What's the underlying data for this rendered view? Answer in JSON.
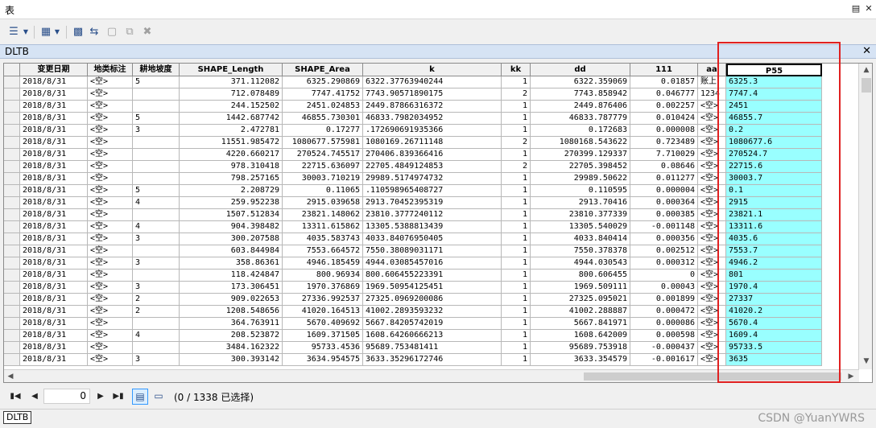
{
  "window": {
    "title": "表"
  },
  "title_controls": [
    "pin-icon",
    "close-icon"
  ],
  "tab": {
    "name": "DLTB"
  },
  "columns": [
    "",
    "变更日期",
    "地类标注",
    "耕地坡度",
    "SHAPE_Length",
    "SHAPE_Area",
    "k",
    "kk",
    "dd",
    "111",
    "aa",
    "P55"
  ],
  "rows": [
    [
      "2018/8/31",
      "<空>",
      "5",
      "371.112082",
      "6325.290869",
      "6322.37763940244",
      "1",
      "6322.359069",
      "0.01857",
      "账上",
      "6325.3"
    ],
    [
      "2018/8/31",
      "<空>",
      "",
      "712.078489",
      "7747.41752",
      "7743.9057189017​5",
      "2",
      "7743.858942",
      "0.046777",
      "1234",
      "7747.4"
    ],
    [
      "2018/8/31",
      "<空>",
      "",
      "244.152502",
      "2451.024853",
      "2449.87866316372",
      "1",
      "2449.876406",
      "0.002257",
      "<空>",
      "2451"
    ],
    [
      "2018/8/31",
      "<空>",
      "5",
      "1442.687742",
      "46855.730301",
      "46833.7982034952",
      "1",
      "46833.787779",
      "0.010424",
      "<空>",
      "46855.7"
    ],
    [
      "2018/8/31",
      "<空>",
      "3",
      "2.472781",
      "0.17277",
      ".172690691935366",
      "1",
      "0.172683",
      "0.000008",
      "<空>",
      "0.2"
    ],
    [
      "2018/8/31",
      "<空>",
      "",
      "11551.985472",
      "1080677.575981",
      "1080169.26711148",
      "2",
      "1080168.543622",
      "0.723489",
      "<空>",
      "1080677.6"
    ],
    [
      "2018/8/31",
      "<空>",
      "",
      "4220.660217",
      "270524.745517",
      "270406.839366416",
      "1",
      "270399.129337",
      "7.710029",
      "<空>",
      "270524.7"
    ],
    [
      "2018/8/31",
      "<空>",
      "",
      "978.310418",
      "22715.636097",
      "22705.4849124853",
      "2",
      "22705.398452",
      "0.08646",
      "<空>",
      "22715.6"
    ],
    [
      "2018/8/31",
      "<空>",
      "",
      "798.257165",
      "30003.710219",
      "29989.5174974732",
      "1",
      "29989.50622",
      "0.011277",
      "<空>",
      "30003.7"
    ],
    [
      "2018/8/31",
      "<空>",
      "5",
      "2.208729",
      "0.11065",
      ".110598965408727",
      "1",
      "0.110595",
      "0.000004",
      "<空>",
      "0.1"
    ],
    [
      "2018/8/31",
      "<空>",
      "4",
      "259.952238",
      "2915.039658",
      "2913.70452395319",
      "1",
      "2913.70416",
      "0.000364",
      "<空>",
      "2915"
    ],
    [
      "2018/8/31",
      "<空>",
      "",
      "1507.512834",
      "23821.148062",
      "23810.3777240112",
      "1",
      "23810.377339",
      "0.000385",
      "<空>",
      "23821.1"
    ],
    [
      "2018/8/31",
      "<空>",
      "4",
      "904.398482",
      "13311.615862",
      "13305.5388813439",
      "1",
      "13305.540029",
      "-0.001148",
      "<空>",
      "13311.6"
    ],
    [
      "2018/8/31",
      "<空>",
      "3",
      "300.207588",
      "4035.583743",
      "4033.84076950405",
      "1",
      "4033.840414",
      "0.000356",
      "<空>",
      "4035.6"
    ],
    [
      "2018/8/31",
      "<空>",
      "",
      "603.844984",
      "7553.664572",
      "7550.38089031171",
      "1",
      "7550.378378",
      "0.002512",
      "<空>",
      "7553.7"
    ],
    [
      "2018/8/31",
      "<空>",
      "3",
      "358.86361",
      "4946.185459",
      "4944.03085457016",
      "1",
      "4944.030543",
      "0.000312",
      "<空>",
      "4946.2"
    ],
    [
      "2018/8/31",
      "<空>",
      "",
      "118.424847",
      "800.96934",
      "800.606455223391",
      "1",
      "800.606455",
      "0",
      "<空>",
      "801"
    ],
    [
      "2018/8/31",
      "<空>",
      "3",
      "173.306451",
      "1970.376869",
      "1969.50954125451",
      "1",
      "1969.509111",
      "0.00043",
      "<空>",
      "1970.4"
    ],
    [
      "2018/8/31",
      "<空>",
      "2",
      "909.022653",
      "27336.992537",
      "27325.0969200086",
      "1",
      "27325.095021",
      "0.001899",
      "<空>",
      "27337"
    ],
    [
      "2018/8/31",
      "<空>",
      "2",
      "1208.548656",
      "41020.164513",
      "41002.2893593232",
      "1",
      "41002.288887",
      "0.000472",
      "<空>",
      "41020.2"
    ],
    [
      "2018/8/31",
      "<空>",
      "",
      "364.763911",
      "5670.409692",
      "5667.84205742019",
      "1",
      "5667.841971",
      "0.000086",
      "<空>",
      "5670.4"
    ],
    [
      "2018/8/31",
      "<空>",
      "4",
      "208.523872",
      "1609.371505",
      "1608.64260666213",
      "1",
      "1608.642009",
      "0.000598",
      "<空>",
      "1609.4"
    ],
    [
      "2018/8/31",
      "<空>",
      "",
      "3484.162322",
      "95733.4536",
      "95689.753481411",
      "1",
      "95689.753918",
      "-0.000437",
      "<空>",
      "95733.5"
    ],
    [
      "2018/8/31",
      "<空>",
      "3",
      "300.393142",
      "3634.954575",
      "3633.35296172746",
      "1",
      "3633.354579",
      "-0.001617",
      "<空>",
      "3635"
    ]
  ],
  "navigation": {
    "record": "0",
    "selection_info": "(0 / 1338 已选择)"
  },
  "bottom_tab": "DLTB",
  "watermark": "CSDN @YuanYWRS",
  "colors": {
    "highlight": "#99ffff",
    "annotation": "#e02020",
    "tab_header": "#d6e3f4"
  }
}
